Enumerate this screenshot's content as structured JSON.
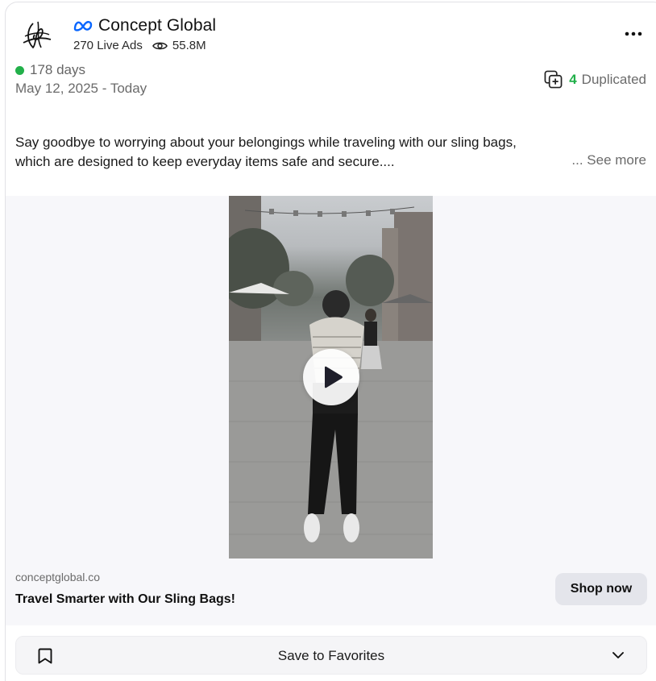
{
  "advertiser": {
    "name": "Concept Global",
    "live_ads": "270 Live Ads",
    "views": "55.8M",
    "logo_icon": "signature-logo-icon",
    "platform_icon": "meta-icon"
  },
  "status": {
    "days_active": "178 days",
    "date_range": "May 12, 2025 - Today",
    "active_color": "#22b04a"
  },
  "duplicated": {
    "count": "4",
    "label": "Duplicated"
  },
  "ad": {
    "text_line1": "Say goodbye to worrying about your belongings while traveling with our sling bags,",
    "text_line2": "which are designed to keep everyday items safe and secure....",
    "see_more": "... See more",
    "domain": "conceptglobal.co",
    "headline": "Travel Smarter with Our Sling Bags!",
    "cta": "Shop now"
  },
  "favorites": {
    "label": "Save to Favorites"
  },
  "icons": {
    "more": "more-horizontal-icon",
    "eye": "eye-icon",
    "duplicate": "duplicate-icon",
    "play": "play-icon",
    "bookmark": "bookmark-icon",
    "chevron": "chevron-down-icon"
  }
}
